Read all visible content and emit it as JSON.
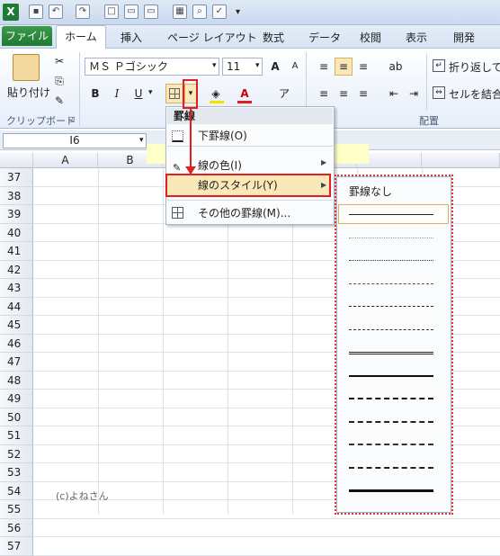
{
  "tabs": [
    "ファイル",
    "ホーム",
    "挿入",
    "ページ レイアウト",
    "数式",
    "データ",
    "校閲",
    "表示",
    "開発"
  ],
  "ribbon": {
    "clipboard": {
      "paste_label": "貼り付け",
      "group_label": "クリップボード"
    },
    "font": {
      "name": "ＭＳ Ｐゴシック",
      "size": "11",
      "bold": "B",
      "italic": "I",
      "underline": "U"
    },
    "alignment": {
      "wrap_label": "折り返して全",
      "merge_label": "セルを結合",
      "group_label": "配置"
    }
  },
  "namebox": "I6",
  "columns": [
    "A",
    "B"
  ],
  "rows": [
    "37",
    "38",
    "39",
    "40",
    "41",
    "42",
    "43",
    "44",
    "45",
    "46",
    "47",
    "48",
    "49",
    "50",
    "51",
    "52",
    "53",
    "54",
    "55",
    "56",
    "57"
  ],
  "menu": {
    "header": "罫線",
    "items": [
      {
        "label": "下罫線(O)"
      },
      {
        "label": "線の色(I)"
      },
      {
        "label": "線のスタイル(Y)"
      },
      {
        "label": "その他の罫線(M)..."
      }
    ]
  },
  "submenu": {
    "none_label": "罫線なし",
    "styles": [
      "thin-solid",
      "hair",
      "dotted",
      "dash-dot-dot-fine",
      "dash-dot",
      "dash-dot-dot",
      "double",
      "medium-solid",
      "medium-dashed",
      "medium-dash-dot",
      "medium-dash-dot-dot",
      "slant-dash-dot",
      "thick-solid"
    ]
  },
  "credit": "(c)よねさん"
}
